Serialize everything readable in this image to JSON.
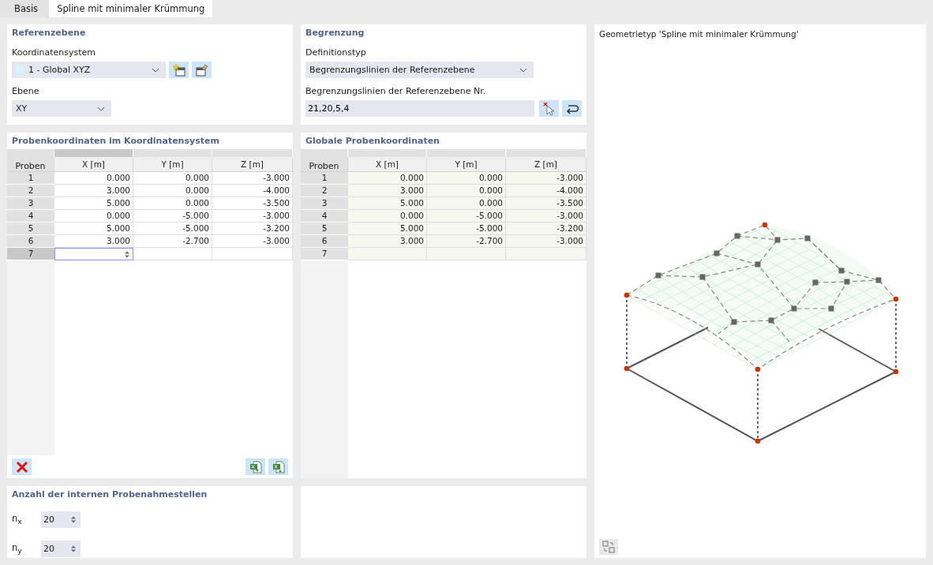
{
  "tabs": [
    {
      "label": "Basis",
      "selected": false
    },
    {
      "label": "Spline mit minimaler Krümmung",
      "selected": true
    }
  ],
  "reference_plane": {
    "title": "Referenzebene",
    "coordinate_system_label": "Koordinatensystem",
    "coordinate_system": {
      "value": "1 - Global XYZ",
      "color": "#d4f6fa"
    },
    "plane_label": "Ebene",
    "plane": "XY"
  },
  "boundary": {
    "title": "Begrenzung",
    "definition_type_label": "Definitionstyp",
    "definition_type": "Begrenzungslinien der Referenzebene",
    "lines_label": "Begrenzungslinien der Referenzebene Nr.",
    "lines": "21,20,5,4"
  },
  "sample_table": {
    "title": "Probenkoordinaten im Koordinatensystem",
    "columns": [
      "Proben",
      "X [m]",
      "Y [m]",
      "Z [m]"
    ],
    "rows": [
      {
        "number": "1",
        "values": [
          "0.000",
          "0.000",
          "-3.000"
        ],
        "selected": false
      },
      {
        "number": "2",
        "values": [
          "3.000",
          "0.000",
          "-4.000"
        ],
        "selected": false
      },
      {
        "number": "3",
        "values": [
          "5.000",
          "0.000",
          "-3.500"
        ],
        "selected": false
      },
      {
        "number": "4",
        "values": [
          "0.000",
          "-5.000",
          "-3.000"
        ],
        "selected": false
      },
      {
        "number": "5",
        "values": [
          "5.000",
          "-5.000",
          "-3.200"
        ],
        "selected": false
      },
      {
        "number": "6",
        "values": [
          "3.000",
          "-2.700",
          "-3.000"
        ],
        "selected": false
      },
      {
        "number": "7",
        "values": [],
        "selected": true
      }
    ]
  },
  "global_table": {
    "title": "Globale Probenkoordinaten",
    "columns": [
      "Proben",
      "X [m]",
      "Y [m]",
      "Z [m]"
    ],
    "rows": [
      {
        "number": "1",
        "values": [
          "0.000",
          "0.000",
          "-3.000"
        ]
      },
      {
        "number": "2",
        "values": [
          "3.000",
          "0.000",
          "-4.000"
        ]
      },
      {
        "number": "3",
        "values": [
          "5.000",
          "0.000",
          "-3.500"
        ]
      },
      {
        "number": "4",
        "values": [
          "0.000",
          "-5.000",
          "-3.000"
        ]
      },
      {
        "number": "5",
        "values": [
          "5.000",
          "-5.000",
          "-3.200"
        ]
      },
      {
        "number": "6",
        "values": [
          "3.000",
          "-2.700",
          "-3.000"
        ]
      },
      {
        "number": "7",
        "values": []
      }
    ]
  },
  "internal_points": {
    "title": "Anzahl der internen Probenahmestellen",
    "counts": [
      {
        "label": "n$_{x}$",
        "value": "20"
      },
      {
        "label": "n$_{y}$",
        "value": "20"
      }
    ]
  },
  "preview": {
    "title": "Geometrietyp 'Spline mit minimaler Krümmung'"
  }
}
